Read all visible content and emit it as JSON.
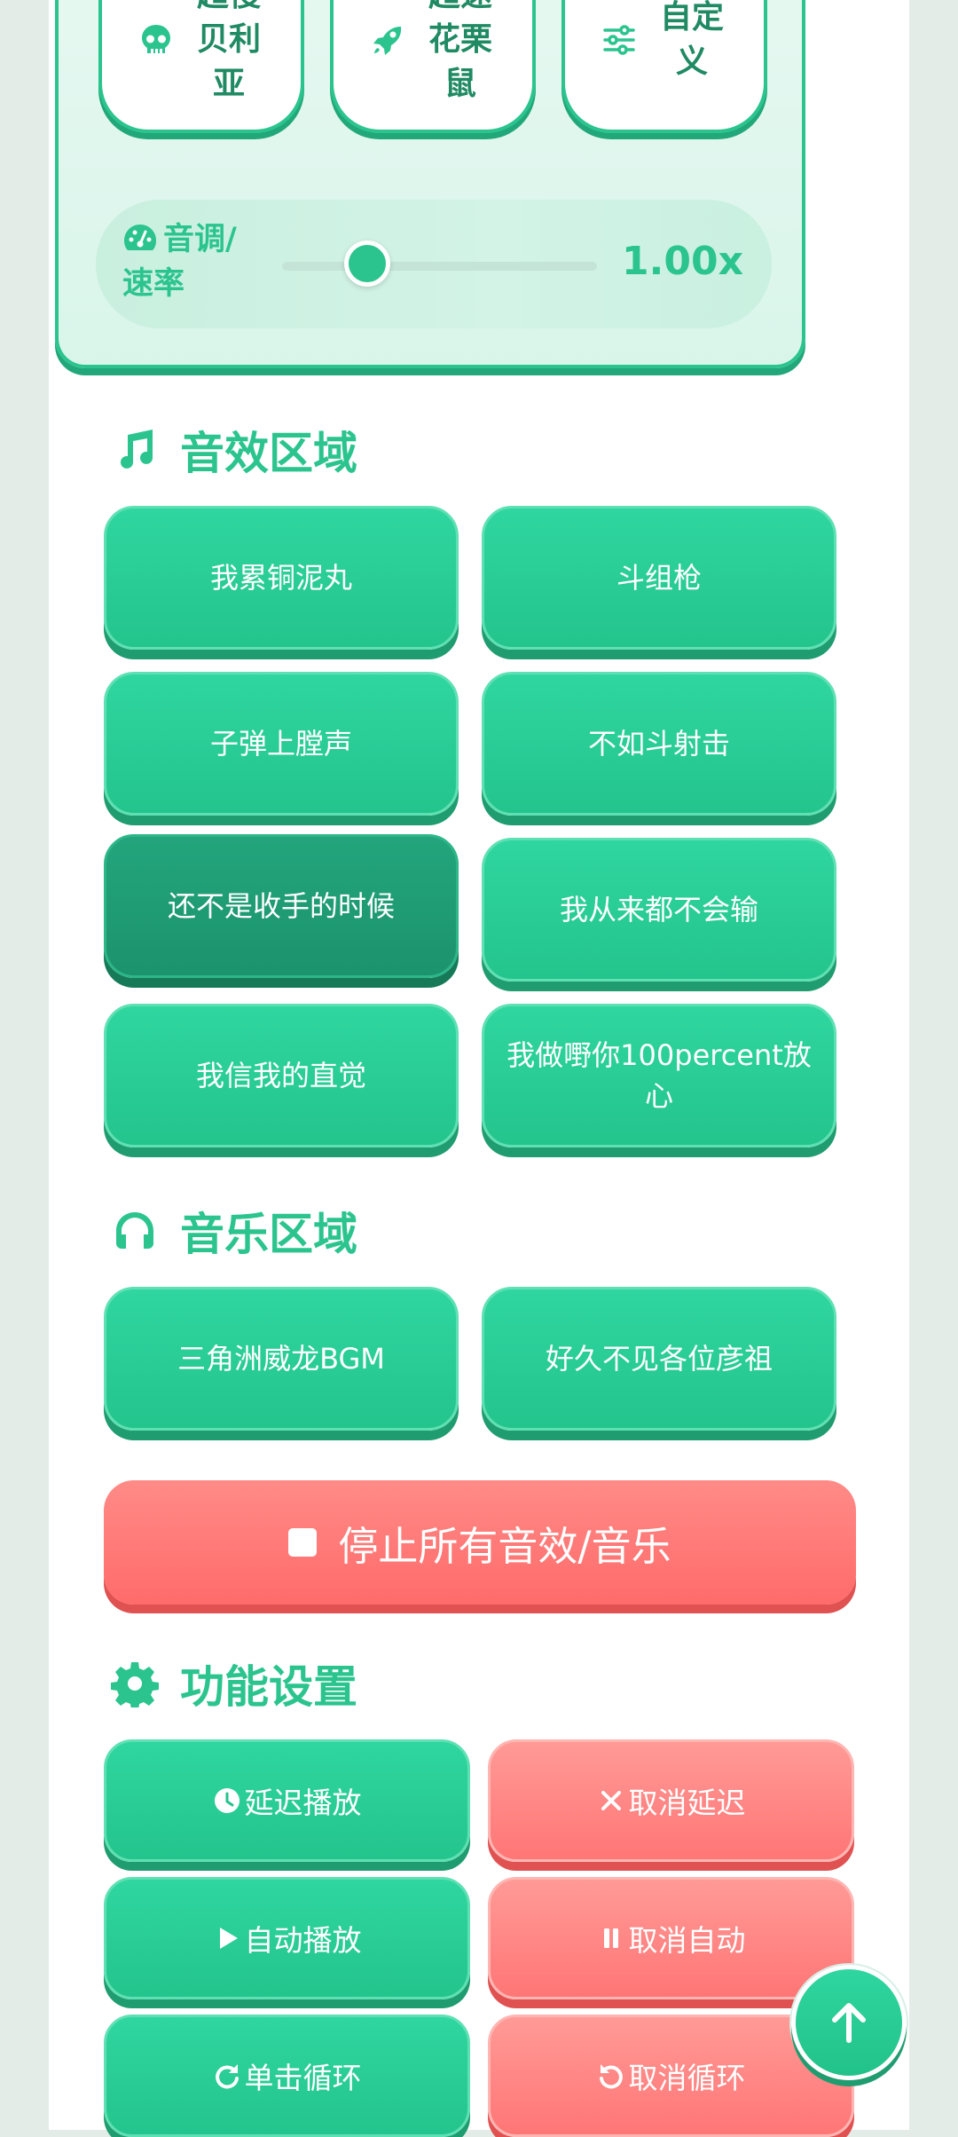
{
  "voice_modes": [
    {
      "label": "超慢贝利亚",
      "icon": "skull-icon"
    },
    {
      "label": "超速花栗鼠",
      "icon": "rocket-icon"
    },
    {
      "label": "自定义",
      "icon": "sliders-icon"
    }
  ],
  "pitch": {
    "label": "音调/速率",
    "value_text": "1.00x",
    "slider_fraction": 0.27
  },
  "sound_section": {
    "title": "音效区域",
    "icon": "music-note-icon"
  },
  "sound_buttons": [
    "我累铜泥丸",
    "斗组枪",
    "子弹上膛声",
    "不如斗射击",
    "还不是收手的时候",
    "我从来都不会输",
    "我信我的直觉",
    "我做嘢你100percent放心"
  ],
  "music_section": {
    "title": "音乐区域",
    "icon": "headphones-icon"
  },
  "music_buttons": [
    "三角洲威龙BGM",
    "好久不见各位彦祖"
  ],
  "stop_button": {
    "label": "停止所有音效/音乐",
    "icon": "stop-icon"
  },
  "settings_section": {
    "title": "功能设置",
    "icon": "gear-icon"
  },
  "settings_buttons": [
    {
      "label": "延迟播放",
      "icon": "clock-icon"
    },
    {
      "label": "取消延迟",
      "icon": "close-icon"
    },
    {
      "label": "自动播放",
      "icon": "play-icon"
    },
    {
      "label": "取消自动",
      "icon": "pause-icon"
    },
    {
      "label": "单击循环",
      "icon": "redo-icon"
    },
    {
      "label": "取消循环",
      "icon": "undo-icon"
    }
  ],
  "scroll_top": {
    "icon": "arrow-up-icon"
  },
  "colors": {
    "accent": "#2bc48f",
    "danger": "#ff6b6b",
    "background": "#e4ece8"
  }
}
